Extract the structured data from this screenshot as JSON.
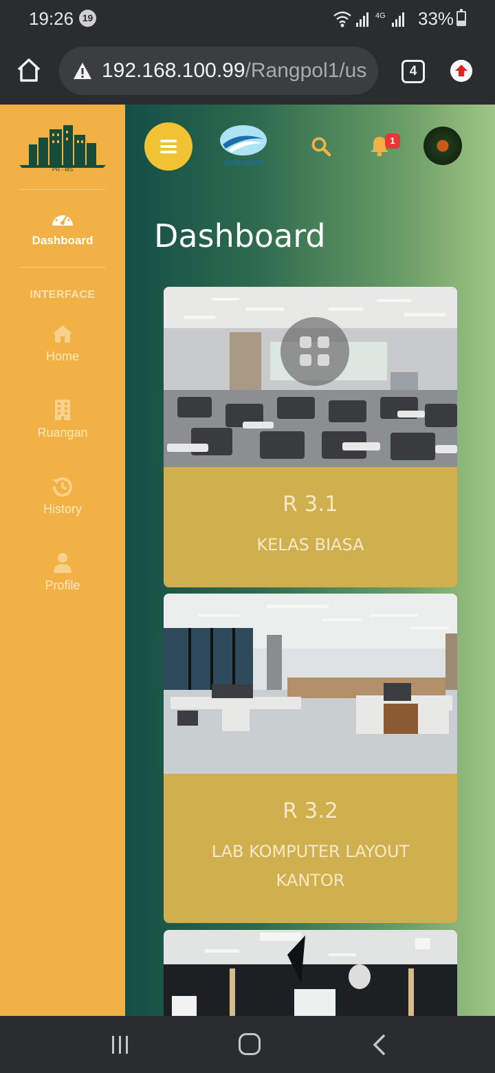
{
  "status_bar": {
    "time": "19:26",
    "notification_count": "19",
    "network_label": "4G",
    "battery": "33%"
  },
  "browser": {
    "url_host": "192.168.100.99",
    "url_path": "/Rangpol1/us",
    "tab_count": "4"
  },
  "sidebar": {
    "logo_text": "PR - MS",
    "active_item": {
      "label": "Dashboard",
      "icon": "tachometer-icon"
    },
    "section_heading": "INTERFACE",
    "items": [
      {
        "label": "Home",
        "icon": "home-icon"
      },
      {
        "label": "Ruangan",
        "icon": "building-icon"
      },
      {
        "label": "History",
        "icon": "history-icon"
      },
      {
        "label": "Profile",
        "icon": "user-icon"
      }
    ]
  },
  "topbar": {
    "logo_text": "polibatam",
    "notification_badge": "1"
  },
  "page": {
    "title": "Dashboard"
  },
  "rooms": [
    {
      "code": "R 3.1",
      "type": "KELAS BIASA"
    },
    {
      "code": "R 3.2",
      "type": "LAB KOMPUTER LAYOUT KANTOR"
    },
    {
      "code": "",
      "type": ""
    }
  ],
  "colors": {
    "sidebar": "#f2b145",
    "card": "#cfaf4e",
    "main_gradient_start": "#144e46",
    "main_gradient_end": "#9fc685",
    "accent_button": "#f1c232",
    "badge": "#e53935"
  }
}
